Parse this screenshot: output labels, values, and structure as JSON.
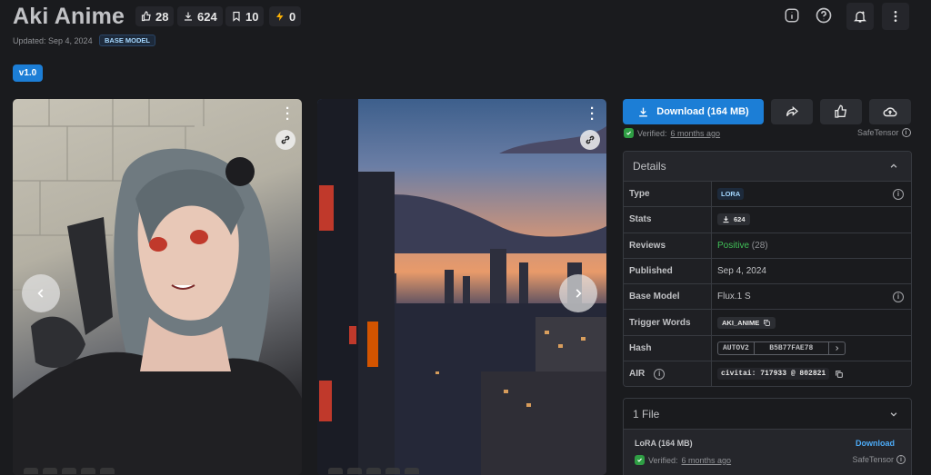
{
  "header": {
    "title": "Aki Anime",
    "stats": [
      {
        "icon": "thumbs-up-icon",
        "value": "28"
      },
      {
        "icon": "download-icon",
        "value": "624"
      },
      {
        "icon": "bookmark-icon",
        "value": "10"
      },
      {
        "icon": "lightning-icon",
        "value": "0"
      }
    ],
    "updated": "Updated: Sep 4, 2024",
    "base_badge": "BASE MODEL",
    "version": "v1.0"
  },
  "actions": {
    "download_label": "Download (164 MB)",
    "verified_prefix": "Verified:",
    "verified_time": "6 months ago",
    "safetensor": "SafeTensor"
  },
  "details": {
    "title": "Details",
    "rows": {
      "type": {
        "k": "Type",
        "v": "LORA"
      },
      "stats": {
        "k": "Stats",
        "v": "624"
      },
      "reviews": {
        "k": "Reviews",
        "v": "Positive",
        "count": "(28)"
      },
      "published": {
        "k": "Published",
        "v": "Sep 4, 2024"
      },
      "base_model": {
        "k": "Base Model",
        "v": "Flux.1 S"
      },
      "trigger": {
        "k": "Trigger Words",
        "v": "AKI_ANIME"
      },
      "hash": {
        "k": "Hash",
        "algo": "AUTOV2",
        "v": "B5B77FAE78"
      },
      "air": {
        "k": "AIR",
        "v": "civitai: 717933 @ 802821"
      }
    }
  },
  "files": {
    "title": "1 File",
    "name": "LoRA (164 MB)",
    "download": "Download",
    "verified_prefix": "Verified:",
    "verified_time": "6 months ago",
    "safetensor": "SafeTensor"
  },
  "colors": {
    "accent": "#1c7ed6",
    "positive": "#40c057",
    "bg": "#1a1b1e"
  }
}
